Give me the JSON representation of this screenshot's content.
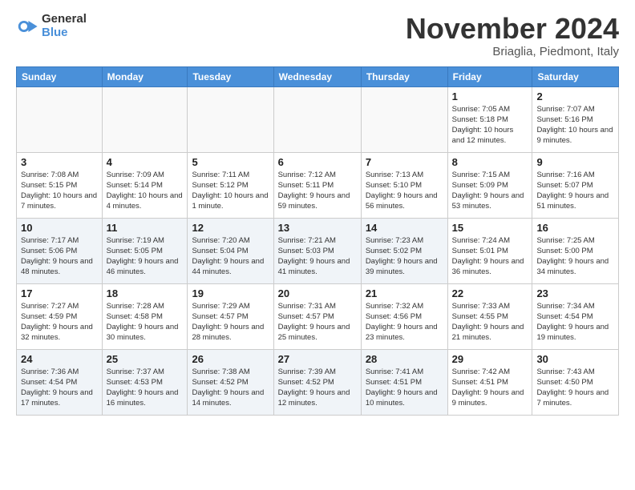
{
  "logo": {
    "general": "General",
    "blue": "Blue"
  },
  "title": "November 2024",
  "subtitle": "Briaglia, Piedmont, Italy",
  "days_of_week": [
    "Sunday",
    "Monday",
    "Tuesday",
    "Wednesday",
    "Thursday",
    "Friday",
    "Saturday"
  ],
  "weeks": [
    [
      {
        "day": "",
        "empty": true
      },
      {
        "day": "",
        "empty": true
      },
      {
        "day": "",
        "empty": true
      },
      {
        "day": "",
        "empty": true
      },
      {
        "day": "",
        "empty": true
      },
      {
        "day": "1",
        "info": "Sunrise: 7:05 AM\nSunset: 5:18 PM\nDaylight: 10 hours and 12 minutes."
      },
      {
        "day": "2",
        "info": "Sunrise: 7:07 AM\nSunset: 5:16 PM\nDaylight: 10 hours and 9 minutes."
      }
    ],
    [
      {
        "day": "3",
        "info": "Sunrise: 7:08 AM\nSunset: 5:15 PM\nDaylight: 10 hours and 7 minutes."
      },
      {
        "day": "4",
        "info": "Sunrise: 7:09 AM\nSunset: 5:14 PM\nDaylight: 10 hours and 4 minutes."
      },
      {
        "day": "5",
        "info": "Sunrise: 7:11 AM\nSunset: 5:12 PM\nDaylight: 10 hours and 1 minute."
      },
      {
        "day": "6",
        "info": "Sunrise: 7:12 AM\nSunset: 5:11 PM\nDaylight: 9 hours and 59 minutes."
      },
      {
        "day": "7",
        "info": "Sunrise: 7:13 AM\nSunset: 5:10 PM\nDaylight: 9 hours and 56 minutes."
      },
      {
        "day": "8",
        "info": "Sunrise: 7:15 AM\nSunset: 5:09 PM\nDaylight: 9 hours and 53 minutes."
      },
      {
        "day": "9",
        "info": "Sunrise: 7:16 AM\nSunset: 5:07 PM\nDaylight: 9 hours and 51 minutes."
      }
    ],
    [
      {
        "day": "10",
        "info": "Sunrise: 7:17 AM\nSunset: 5:06 PM\nDaylight: 9 hours and 48 minutes."
      },
      {
        "day": "11",
        "info": "Sunrise: 7:19 AM\nSunset: 5:05 PM\nDaylight: 9 hours and 46 minutes."
      },
      {
        "day": "12",
        "info": "Sunrise: 7:20 AM\nSunset: 5:04 PM\nDaylight: 9 hours and 44 minutes."
      },
      {
        "day": "13",
        "info": "Sunrise: 7:21 AM\nSunset: 5:03 PM\nDaylight: 9 hours and 41 minutes."
      },
      {
        "day": "14",
        "info": "Sunrise: 7:23 AM\nSunset: 5:02 PM\nDaylight: 9 hours and 39 minutes."
      },
      {
        "day": "15",
        "info": "Sunrise: 7:24 AM\nSunset: 5:01 PM\nDaylight: 9 hours and 36 minutes."
      },
      {
        "day": "16",
        "info": "Sunrise: 7:25 AM\nSunset: 5:00 PM\nDaylight: 9 hours and 34 minutes."
      }
    ],
    [
      {
        "day": "17",
        "info": "Sunrise: 7:27 AM\nSunset: 4:59 PM\nDaylight: 9 hours and 32 minutes."
      },
      {
        "day": "18",
        "info": "Sunrise: 7:28 AM\nSunset: 4:58 PM\nDaylight: 9 hours and 30 minutes."
      },
      {
        "day": "19",
        "info": "Sunrise: 7:29 AM\nSunset: 4:57 PM\nDaylight: 9 hours and 28 minutes."
      },
      {
        "day": "20",
        "info": "Sunrise: 7:31 AM\nSunset: 4:57 PM\nDaylight: 9 hours and 25 minutes."
      },
      {
        "day": "21",
        "info": "Sunrise: 7:32 AM\nSunset: 4:56 PM\nDaylight: 9 hours and 23 minutes."
      },
      {
        "day": "22",
        "info": "Sunrise: 7:33 AM\nSunset: 4:55 PM\nDaylight: 9 hours and 21 minutes."
      },
      {
        "day": "23",
        "info": "Sunrise: 7:34 AM\nSunset: 4:54 PM\nDaylight: 9 hours and 19 minutes."
      }
    ],
    [
      {
        "day": "24",
        "info": "Sunrise: 7:36 AM\nSunset: 4:54 PM\nDaylight: 9 hours and 17 minutes."
      },
      {
        "day": "25",
        "info": "Sunrise: 7:37 AM\nSunset: 4:53 PM\nDaylight: 9 hours and 16 minutes."
      },
      {
        "day": "26",
        "info": "Sunrise: 7:38 AM\nSunset: 4:52 PM\nDaylight: 9 hours and 14 minutes."
      },
      {
        "day": "27",
        "info": "Sunrise: 7:39 AM\nSunset: 4:52 PM\nDaylight: 9 hours and 12 minutes."
      },
      {
        "day": "28",
        "info": "Sunrise: 7:41 AM\nSunset: 4:51 PM\nDaylight: 9 hours and 10 minutes."
      },
      {
        "day": "29",
        "info": "Sunrise: 7:42 AM\nSunset: 4:51 PM\nDaylight: 9 hours and 9 minutes."
      },
      {
        "day": "30",
        "info": "Sunrise: 7:43 AM\nSunset: 4:50 PM\nDaylight: 9 hours and 7 minutes."
      }
    ]
  ]
}
